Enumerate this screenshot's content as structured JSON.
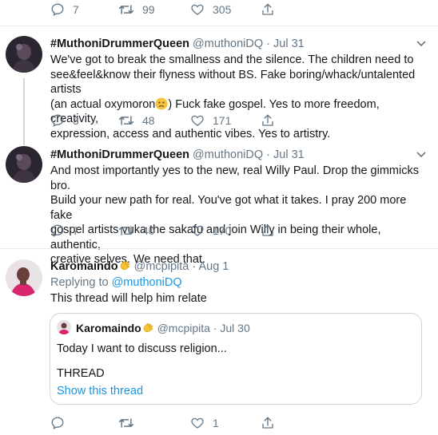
{
  "tweet0": {
    "reply_count": "7",
    "retweet_count": "99",
    "like_count": "305"
  },
  "tweet1": {
    "name": "#MuthoniDrummerQueen",
    "handle": "@muthoniDQ",
    "dot": "·",
    "date": "Jul 31",
    "text_line1": "We've got to break the smallness and the silence. The children need to",
    "text_line2": "see&feel&know their flyness without BS. Fake boring/whack/untalented artists",
    "text_line3a": "(an actual oxymoron",
    "text_line3b": ") Fuck fake gospel. Yes to more freedom, creativity,",
    "text_line4": "expression, access and authentic vibes. Yes to artistry.",
    "reply_count": "3",
    "retweet_count": "48",
    "like_count": "171"
  },
  "tweet2": {
    "name": "#MuthoniDrummerQueen",
    "handle": "@muthoniDQ",
    "dot": "·",
    "date": "Jul 31",
    "text_line1": "And most importantly yes to the new, real Willy Paul. Drop the gimmicks bro.",
    "text_line2": "Build your new path for real. You've got what it takes. I pray 200 more fake",
    "text_line3": "gospel artists vuka the sakafu and join Willy in being their whole, authentic,",
    "text_line4": "creative selves. We need that.",
    "reply_count": "7",
    "retweet_count": "40",
    "like_count": "170"
  },
  "tweet3": {
    "name": "Karomaindo",
    "handle": "@mcpipita",
    "dot": "·",
    "date": "Aug 1",
    "replying_prefix": "Replying to",
    "replying_handle": "@muthoniDQ",
    "text": "This thread will help him relate",
    "reply_count": "",
    "retweet_count": "",
    "like_count": "1",
    "quote": {
      "name": "Karomaindo",
      "handle": "@mcpipita",
      "dot": "·",
      "date": "Jul 30",
      "text_line1": "Today I want to discuss religion...",
      "text_line2": "THREAD",
      "show_thread": "Show this thread"
    }
  },
  "colors": {
    "accent": "#1b95e0",
    "muted": "#657786",
    "divider": "#e6ecf0",
    "thread_line": "#ccd6dd"
  }
}
